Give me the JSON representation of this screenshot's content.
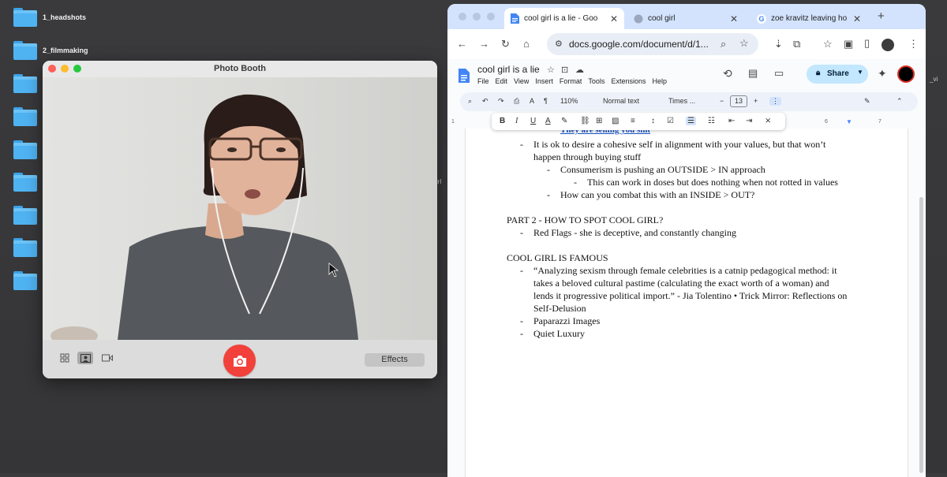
{
  "desktop": {
    "folders": [
      "1_headshots",
      "2_filmmaking"
    ],
    "stray_left": "irl",
    "stray_right": "_vi"
  },
  "photo_booth": {
    "title": "Photo Booth",
    "effects_label": "Effects"
  },
  "browser": {
    "tabs": [
      {
        "label": "cool girl is a lie - Goo"
      },
      {
        "label": "cool girl"
      },
      {
        "label": "zoe kravitz leaving ho"
      }
    ],
    "url": "docs.google.com/document/d/1..."
  },
  "docs": {
    "title": "cool girl is a lie",
    "menus": [
      "File",
      "Edit",
      "View",
      "Insert",
      "Format",
      "Tools",
      "Extensions",
      "Help"
    ],
    "share_label": "Share",
    "toolbar": {
      "zoom": "110%",
      "style": "Normal text",
      "font": "Times ...",
      "font_size": "13"
    },
    "ruler_ticks": [
      "1",
      "6",
      "7"
    ],
    "content": {
      "cut_line": "They are selling you shit",
      "b1": "It is ok to desire a cohesive self in alignment with your values, but that won’t",
      "b1_cont": "happen through buying stuff",
      "b1_1": "Consumerism is pushing an OUTSIDE > IN approach",
      "b1_1_1": "This can work in doses but does nothing when not rotted in values",
      "b1_2": "How can you combat this with an INSIDE  > OUT?",
      "h2": "PART 2 - HOW TO SPOT COOL GIRL?",
      "b2": "Red Flags - she is deceptive, and constantly changing",
      "h3": "COOL GIRL IS FAMOUS",
      "q1": "“Analyzing sexism through female celebrities is a catnip pedagogical method: it",
      "q2": "takes a beloved cultural pastime (calculating the exact worth of a woman) and",
      "q3": "lends it progressive political import.” - Jia Tolentino • Trick Mirror: Reflections on",
      "q4": "Self-Delusion",
      "b4": "Paparazzi Images",
      "b5": "Quiet Luxury"
    }
  },
  "colors": {
    "tab_bar": "#d3e3fd",
    "share_button": "#c2e7ff",
    "shutter": "#f2403a",
    "folder": "#4fb3f2"
  }
}
